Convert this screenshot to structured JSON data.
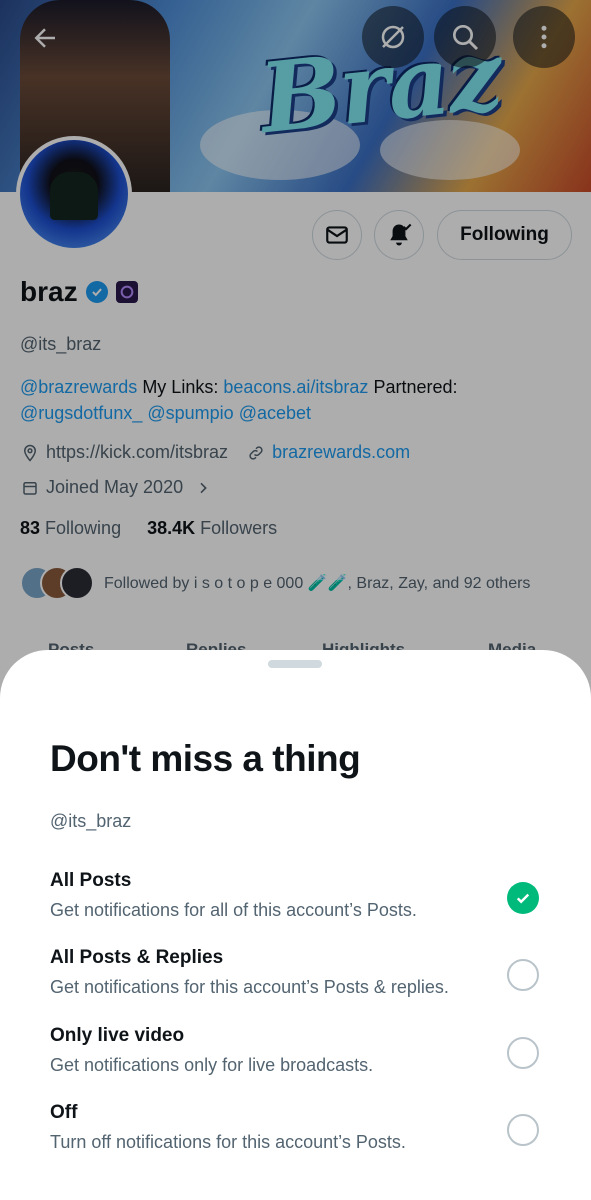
{
  "profile": {
    "banner_text": "Braz",
    "name": "braz",
    "handle": "@its_braz",
    "bio": {
      "mention1": "@brazrewards",
      "text1": " My Links: ",
      "link1": "beacons.ai/itsbraz",
      "text2": " Partnered: ",
      "mention2": "@rugsdotfunx_",
      "mention3": "@spumpio",
      "mention4": "@acebet"
    },
    "location": "https://kick.com/itsbraz",
    "website": "brazrewards.com",
    "joined": "Joined May 2020",
    "following_count": "83",
    "following_label": "Following",
    "followers_count": "38.4K",
    "followers_label": "Followers",
    "followed_by": "Followed by i s o t o p e 000 🧪🧪, Braz, Zay, and 92 others",
    "following_button": "Following",
    "tabs": [
      "Posts",
      "Replies",
      "Highlights",
      "Media"
    ]
  },
  "sheet": {
    "title": "Don't miss a thing",
    "handle": "@its_braz",
    "options": [
      {
        "title": "All Posts",
        "description": "Get notifications for all of this account’s Posts.",
        "selected": true
      },
      {
        "title": "All Posts & Replies",
        "description": "Get notifications for this account’s Posts & replies.",
        "selected": false
      },
      {
        "title": "Only live video",
        "description": "Get notifications only for live broadcasts.",
        "selected": false
      },
      {
        "title": "Off",
        "description": "Turn off notifications for this account’s Posts.",
        "selected": false
      }
    ]
  },
  "colors": {
    "accent": "#1d9bf0",
    "selected": "#00ba7c",
    "text_primary": "#0f1419",
    "text_secondary": "#536471"
  },
  "icons": [
    "back-arrow-icon",
    "grok-icon",
    "search-icon",
    "more-vertical-icon",
    "mail-icon",
    "bell-check-icon",
    "verified-badge-icon",
    "affiliate-badge-icon",
    "location-icon",
    "link-icon",
    "calendar-icon",
    "chevron-right-icon",
    "checkmark-icon"
  ]
}
